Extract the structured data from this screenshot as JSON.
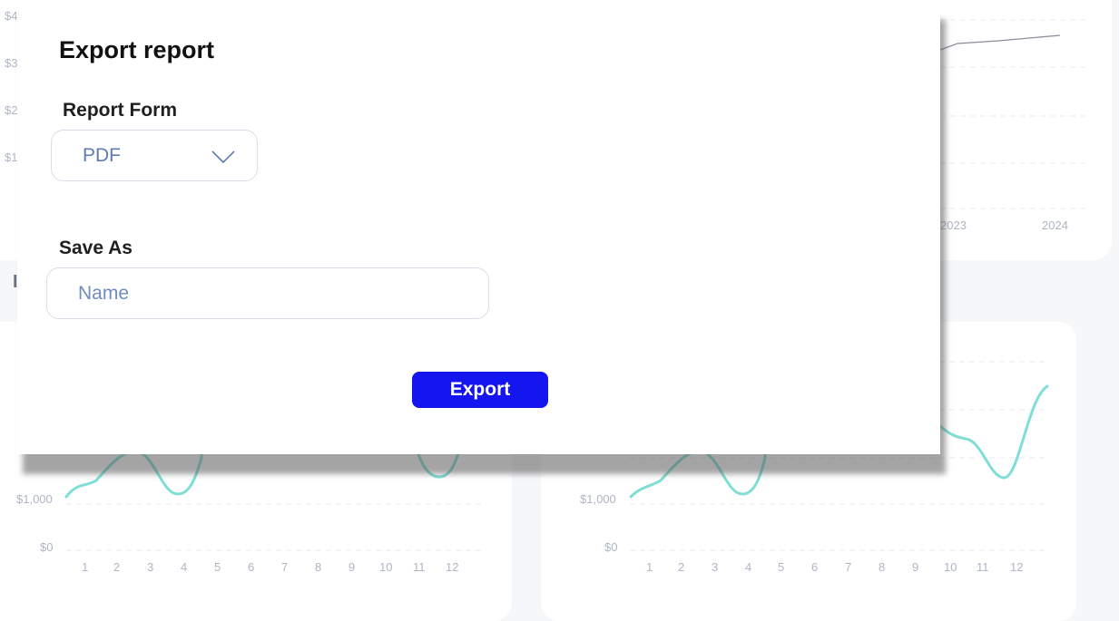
{
  "background": {
    "top_chart": {
      "y_labels": [
        "$4",
        "$3",
        "$2",
        "$1"
      ],
      "x_labels": [
        "2023",
        "2024"
      ]
    },
    "section_peek_text": "I",
    "left_chart": {
      "y_labels": [
        "$1,000",
        "$0"
      ],
      "x_labels": [
        "1",
        "2",
        "3",
        "4",
        "5",
        "6",
        "7",
        "8",
        "9",
        "10",
        "11",
        "12"
      ]
    },
    "right_chart": {
      "y_labels": [
        "$1,000",
        "$0"
      ],
      "x_labels": [
        "1",
        "2",
        "3",
        "4",
        "5",
        "6",
        "7",
        "8",
        "9",
        "10",
        "11",
        "12"
      ]
    },
    "colors": {
      "line": "#7fded6",
      "gridline": "#e6e9ef",
      "axis_text": "#aeb5c3"
    }
  },
  "modal": {
    "title": "Export report",
    "report_form": {
      "label": "Report Form",
      "selected": "PDF",
      "icon": "chevron-down-icon"
    },
    "save_as": {
      "label": "Save As",
      "placeholder": "Name",
      "value": ""
    },
    "export_button": "Export",
    "colors": {
      "primary": "#1515f0",
      "input_text": "#5d7db4"
    }
  }
}
